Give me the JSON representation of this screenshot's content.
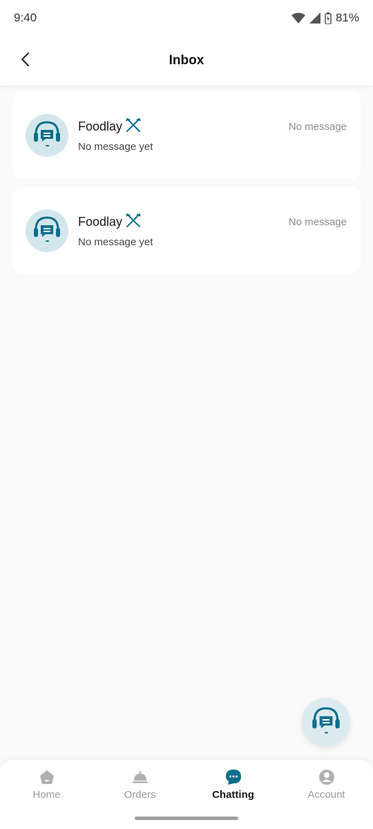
{
  "status_bar": {
    "time": "9:40",
    "battery": "81%"
  },
  "header": {
    "title": "Inbox"
  },
  "conversations": [
    {
      "name": "Foodlay",
      "preview": "No message yet",
      "time_label": "No message"
    },
    {
      "name": "Foodlay",
      "preview": "No message yet",
      "time_label": "No message"
    }
  ],
  "icons": {
    "back": "chevron-left-icon",
    "support": "headset-chat-icon",
    "restaurant": "fork-knife-icon"
  },
  "bottom_nav": {
    "items": [
      {
        "label": "Home",
        "icon": "home-icon"
      },
      {
        "label": "Orders",
        "icon": "cloche-icon"
      },
      {
        "label": "Chatting",
        "icon": "chat-bubble-icon",
        "active": true
      },
      {
        "label": "Account",
        "icon": "user-icon"
      }
    ]
  },
  "colors": {
    "accent": "#0e6f8b",
    "avatar_bg": "#d3e6ec",
    "inactive": "#b0b0b0",
    "background": "#fafafa"
  }
}
